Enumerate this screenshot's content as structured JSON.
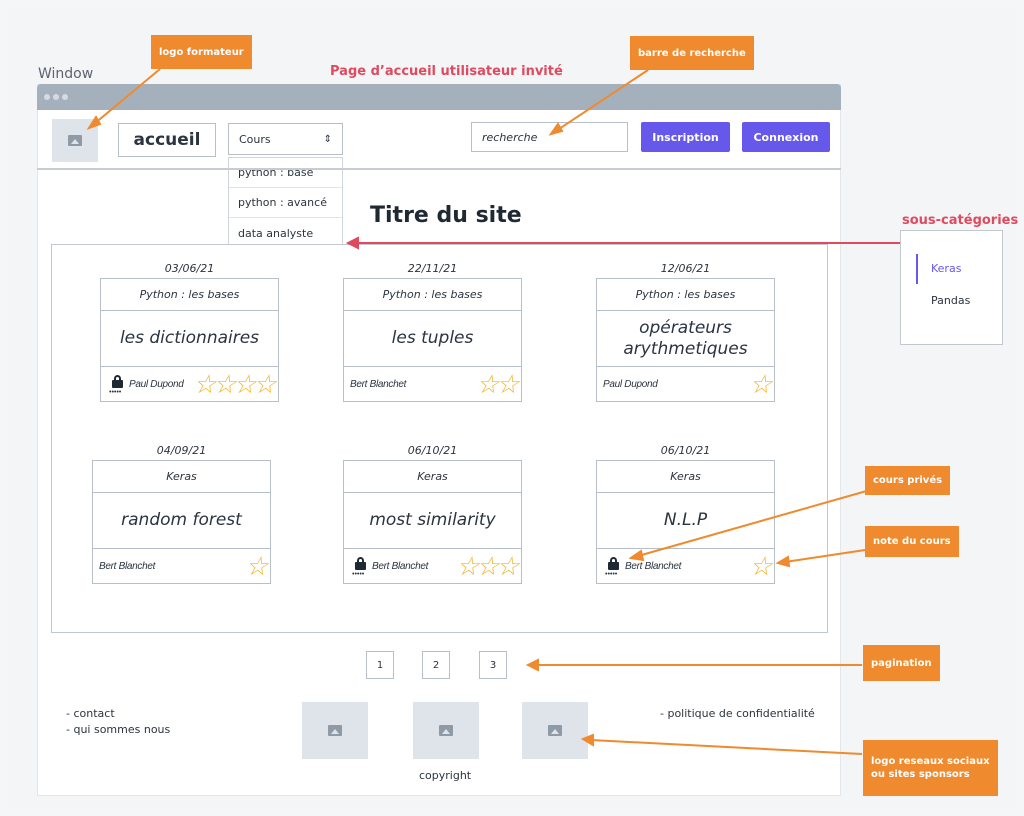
{
  "window": {
    "label": "Window"
  },
  "page_heading": "Page d’accueil utilisateur invité",
  "header": {
    "home_label": "accueil",
    "courses_select": {
      "value": "Cours",
      "arrow": "⇕"
    },
    "dropdown": [
      "python : base",
      "python : avancé",
      "data analyste"
    ],
    "search_value": "recherche",
    "signup_label": "Inscription",
    "login_label": "Connexion"
  },
  "site_title": "Titre du site",
  "cards": [
    {
      "date": "03/06/21",
      "category": "Python : les bases",
      "title": "les dictionnaires",
      "author": "Paul Dupond",
      "private": true,
      "stars": 4
    },
    {
      "date": "22/11/21",
      "category": "Python : les bases",
      "title": "les tuples",
      "author": "Bert Blanchet",
      "private": false,
      "stars": 2
    },
    {
      "date": "12/06/21",
      "category": "Python : les bases",
      "title": "opérateurs arythmetiques",
      "author": "Paul Dupond",
      "private": false,
      "stars": 1
    },
    {
      "date": "04/09/21",
      "category": "Keras",
      "title": "random forest",
      "author": "Bert Blanchet",
      "private": false,
      "stars": 1
    },
    {
      "date": "06/10/21",
      "category": "Keras",
      "title": "most similarity",
      "author": "Bert Blanchet",
      "private": true,
      "stars": 3
    },
    {
      "date": "06/10/21",
      "category": "Keras",
      "title": "N.L.P",
      "author": "Bert Blanchet",
      "private": true,
      "stars": 1
    }
  ],
  "lock_dots": "•••••",
  "star_glyph": "☆",
  "pagination": [
    "1",
    "2",
    "3"
  ],
  "footer": {
    "contact": "- contact",
    "about": "- qui sommes nous",
    "privacy": "- politique de confidentialité",
    "copyright": "copyright"
  },
  "subcategories": {
    "label": "sous-catégories",
    "items": [
      "Keras",
      "Pandas"
    ],
    "active_index": 0
  },
  "callouts": {
    "logo": "logo formateur",
    "search": "barre de recherche",
    "private": "cours privés",
    "rating": "note du cours",
    "pagination": "pagination",
    "social_line1": "logo reseaux sociaux",
    "social_line2": "ou sites sponsors"
  },
  "colors": {
    "accent": "#6558ea",
    "callout": "#ef8a2e",
    "heading_red": "#e04a5f",
    "star": "#f0b429"
  }
}
